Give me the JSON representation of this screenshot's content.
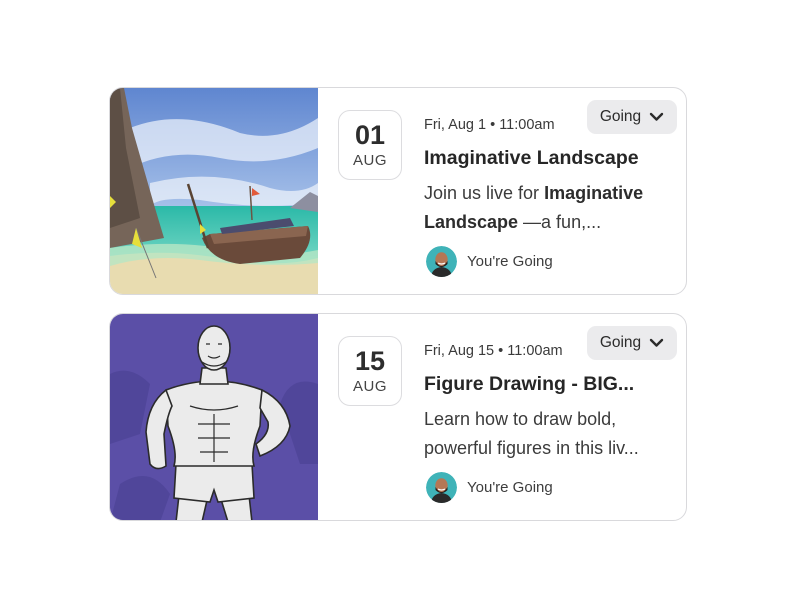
{
  "events": [
    {
      "day": "01",
      "month": "AUG",
      "datetime": "Fri, Aug 1 • 11:00am",
      "rsvp_label": "Going",
      "title": "Imaginative Landscape",
      "desc_pre": "Join us live for ",
      "desc_bold": "Imaginative Landscape",
      "desc_post": " —a fun,...",
      "attendance": "You're Going",
      "thumbnail": "tropical-beach-boat-painting"
    },
    {
      "day": "15",
      "month": "AUG",
      "datetime": "Fri, Aug 15 • 11:00am",
      "rsvp_label": "Going",
      "title": "Figure Drawing - BIG...",
      "desc": "Learn how to draw bold, powerful figures in this liv...",
      "attendance": "You're Going",
      "thumbnail": "muscular-figure-sketch"
    }
  ],
  "colors": {
    "card_border": "#d9d9dc",
    "button_bg": "#ebebed",
    "avatar_bg": "#3fb3b8",
    "figure_bg": "#5b4fa7"
  }
}
